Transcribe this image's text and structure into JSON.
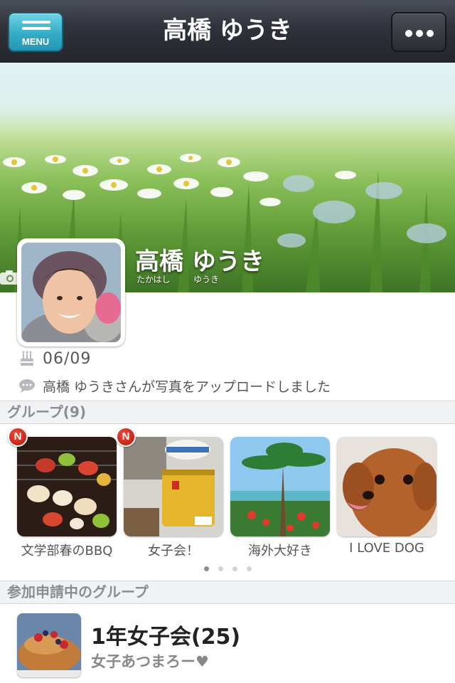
{
  "header": {
    "menu_label": "MENU",
    "title": "高橋 ゆうき"
  },
  "profile": {
    "name": "高橋 ゆうき",
    "furigana_last": "たかはし",
    "furigana_first": "ゆうき",
    "birthday": "06/09",
    "status": "高橋 ゆうきさんが写真をアップロードしました"
  },
  "groups_section": {
    "title": "グループ(9)",
    "groups": [
      {
        "label": "文学部春のBBQ",
        "badge": "N"
      },
      {
        "label": "女子会！",
        "badge": "N"
      },
      {
        "label": "海外大好き"
      },
      {
        "label": "I LOVE DOG"
      }
    ],
    "pager": {
      "pages": 4,
      "current": 1
    }
  },
  "pending_section": {
    "title": "参加申請中のグループ",
    "items": [
      {
        "name": "1年女子会(25)",
        "description": "女子あつまろー♥"
      }
    ]
  },
  "colors": {
    "menu_button": "#34acc7",
    "header_bg": "#2f323a",
    "badge": "#d82d1e"
  },
  "icons": [
    "menu-icon",
    "more-icon",
    "camera-icon",
    "birthday-cake-icon",
    "speech-bubble-icon",
    "new-badge"
  ]
}
